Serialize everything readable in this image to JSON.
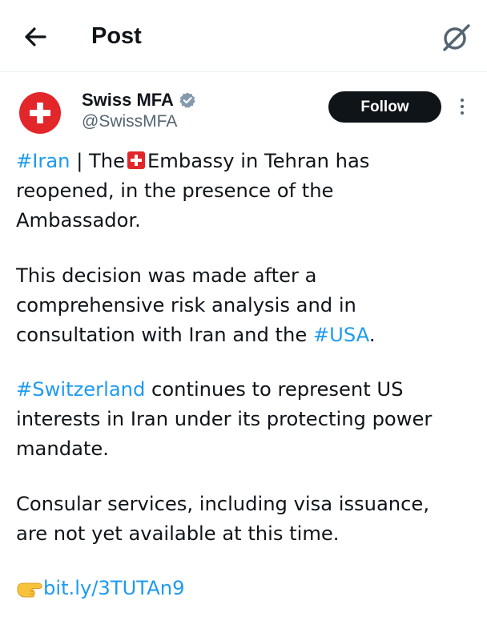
{
  "header": {
    "title": "Post",
    "back_icon": "arrow-left-icon",
    "grok_icon": "grok-icon"
  },
  "author": {
    "display_name": "Swiss MFA",
    "handle": "@SwissMFA",
    "verified_icon": "verified-badge-icon",
    "avatar_color": "#e2262a"
  },
  "actions": {
    "follow_label": "Follow",
    "more_icon": "more-vertical-icon"
  },
  "post": {
    "p1": {
      "hashtag_iran": "#Iran",
      "sep": " | The",
      "flag_icon": "swiss-flag-emoji",
      "rest": "Embassy in Tehran has\nreopened, in the presence of the\nAmbassador."
    },
    "p2": {
      "text": "This decision was made after a\ncomprehensive risk analysis and in\nconsultation with Iran and the ",
      "hashtag_usa": "#USA",
      "end": "."
    },
    "p3": {
      "hashtag_switzerland": "#Switzerland",
      "text": " continues to represent US\ninterests in Iran under its protecting power\nmandate."
    },
    "p4": {
      "text": "Consular services, including visa issuance,\nare not yet available at this time."
    },
    "p5": {
      "emoji_icon": "pointing-hand-emoji",
      "link": "bit.ly/3TUTAn9"
    }
  },
  "colors": {
    "link": "#1d9bf0",
    "text": "#0f1419",
    "secondary": "#536471",
    "swiss_red": "#e2262a"
  }
}
